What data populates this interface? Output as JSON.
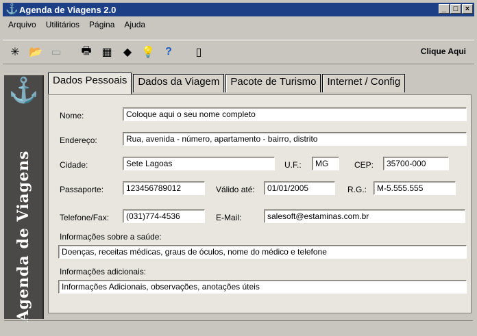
{
  "window": {
    "title": "Agenda de Viagens 2.0",
    "app_icon": "anchor-icon",
    "controls": [
      "minimize",
      "maximize",
      "close"
    ]
  },
  "menu": [
    "Arquivo",
    "Utilitários",
    "Página",
    "Ajuda"
  ],
  "toolbar": {
    "icons": [
      "new-icon",
      "open-icon",
      "save-icon",
      "print-icon",
      "calendar-icon",
      "eraser-icon",
      "lightbulb-icon",
      "help-icon",
      "phone-icon"
    ],
    "clique_label": "Clique Aqui"
  },
  "sidebar": {
    "logo": "anchor-icon",
    "label": "Agenda de Viagens"
  },
  "tabs": [
    "Dados Pessoais",
    "Dados da Viagem",
    "Pacote de Turismo",
    "Internet / Config"
  ],
  "form": {
    "nome_label": "Nome:",
    "nome": "Coloque aqui o seu nome completo",
    "endereco_label": "Endereço:",
    "endereco": "Rua, avenida - número, apartamento - bairro, distrito",
    "cidade_label": "Cidade:",
    "cidade": "Sete Lagoas",
    "uf_label": "U.F.:",
    "uf": "MG",
    "cep_label": "CEP:",
    "cep": "35700-000",
    "passaporte_label": "Passaporte:",
    "passaporte": "123456789012",
    "valido_label": "Válido até:",
    "valido": "01/01/2005",
    "rg_label": "R.G.:",
    "rg": "M-5.555.555",
    "telefone_label": "Telefone/Fax:",
    "telefone": "(031)774-4536",
    "email_label": "E-Mail:",
    "email": "salesoft@estaminas.com.br",
    "saude_label": "Informações sobre a saúde:",
    "saude": "Doenças, receitas médicas, graus de óculos, nome do médico e telefone",
    "adicionais_label": "Informações adicionais:",
    "adicionais": "Informações Adicionais, observações, anotações úteis"
  }
}
